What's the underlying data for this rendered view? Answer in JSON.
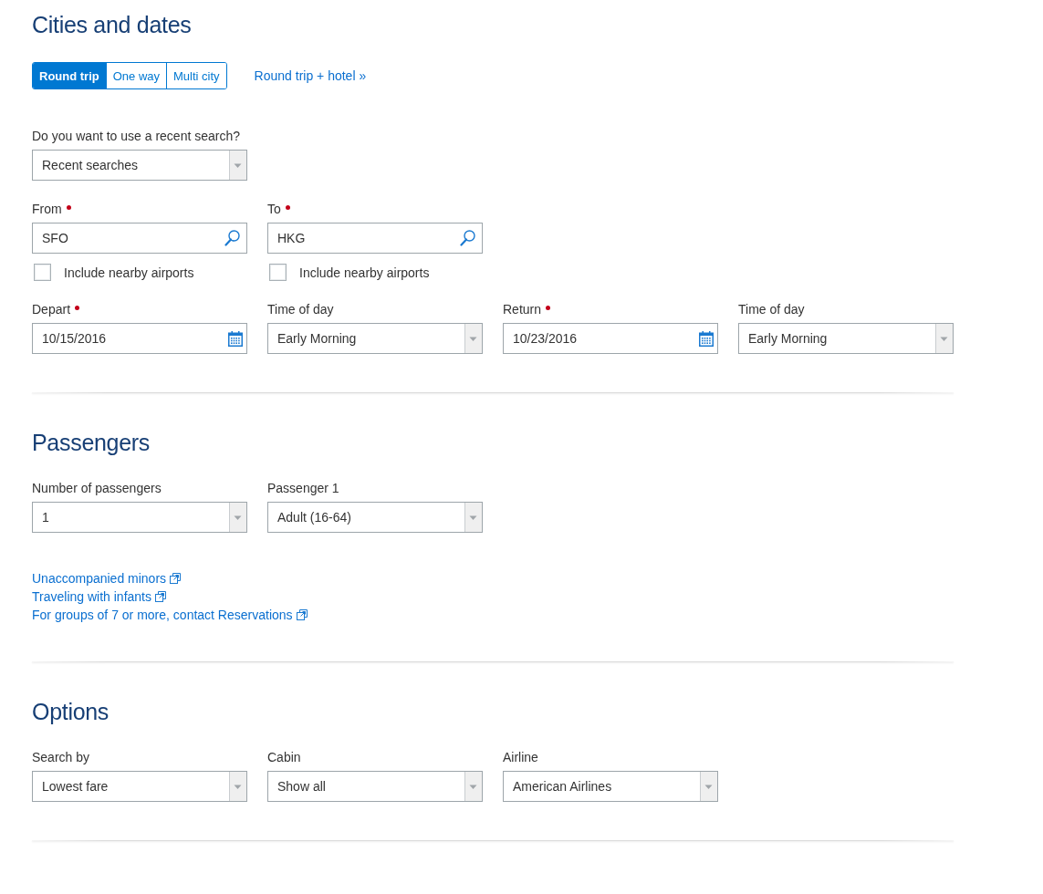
{
  "sections": [
    {
      "title": "Cities and dates",
      "trip_types": [
        {
          "label": "Round trip",
          "selected": true
        },
        {
          "label": "One way",
          "selected": false
        },
        {
          "label": "Multi city",
          "selected": false
        }
      ],
      "hotel_link": "Round trip + hotel »",
      "rows": [
        [
          {
            "kind": "select",
            "label": "Do you want to use a recent search?",
            "required": false,
            "value": "Recent searches"
          }
        ],
        [
          {
            "kind": "search",
            "label": "From",
            "required": true,
            "value": "SFO",
            "nearby": {
              "label": "Include nearby airports",
              "checked": false
            }
          },
          {
            "kind": "search",
            "label": "To",
            "required": true,
            "value": "HKG",
            "nearby": {
              "label": "Include nearby airports",
              "checked": false
            }
          }
        ],
        [
          {
            "kind": "date",
            "label": "Depart",
            "required": true,
            "value": "10/15/2016"
          },
          {
            "kind": "select",
            "label": "Time of day",
            "required": false,
            "value": "Early Morning"
          },
          {
            "kind": "date",
            "label": "Return",
            "required": true,
            "value": "10/23/2016"
          },
          {
            "kind": "select",
            "label": "Time of day",
            "required": false,
            "value": "Early Morning"
          }
        ]
      ]
    },
    {
      "title": "Passengers",
      "rows": [
        [
          {
            "kind": "select",
            "label": "Number of passengers",
            "required": false,
            "value": "1"
          },
          {
            "kind": "select",
            "label": "Passenger 1",
            "required": false,
            "value": "Adult (16-64)"
          }
        ]
      ],
      "links": [
        "Unaccompanied minors",
        "Traveling with infants",
        "For groups of 7 or more, contact Reservations"
      ]
    },
    {
      "title": "Options",
      "rows": [
        [
          {
            "kind": "select",
            "label": "Search by",
            "required": false,
            "value": "Lowest fare"
          },
          {
            "kind": "select",
            "label": "Cabin",
            "required": false,
            "value": "Show all"
          },
          {
            "kind": "select",
            "label": "Airline",
            "required": false,
            "value": "American Airlines"
          }
        ]
      ]
    }
  ]
}
